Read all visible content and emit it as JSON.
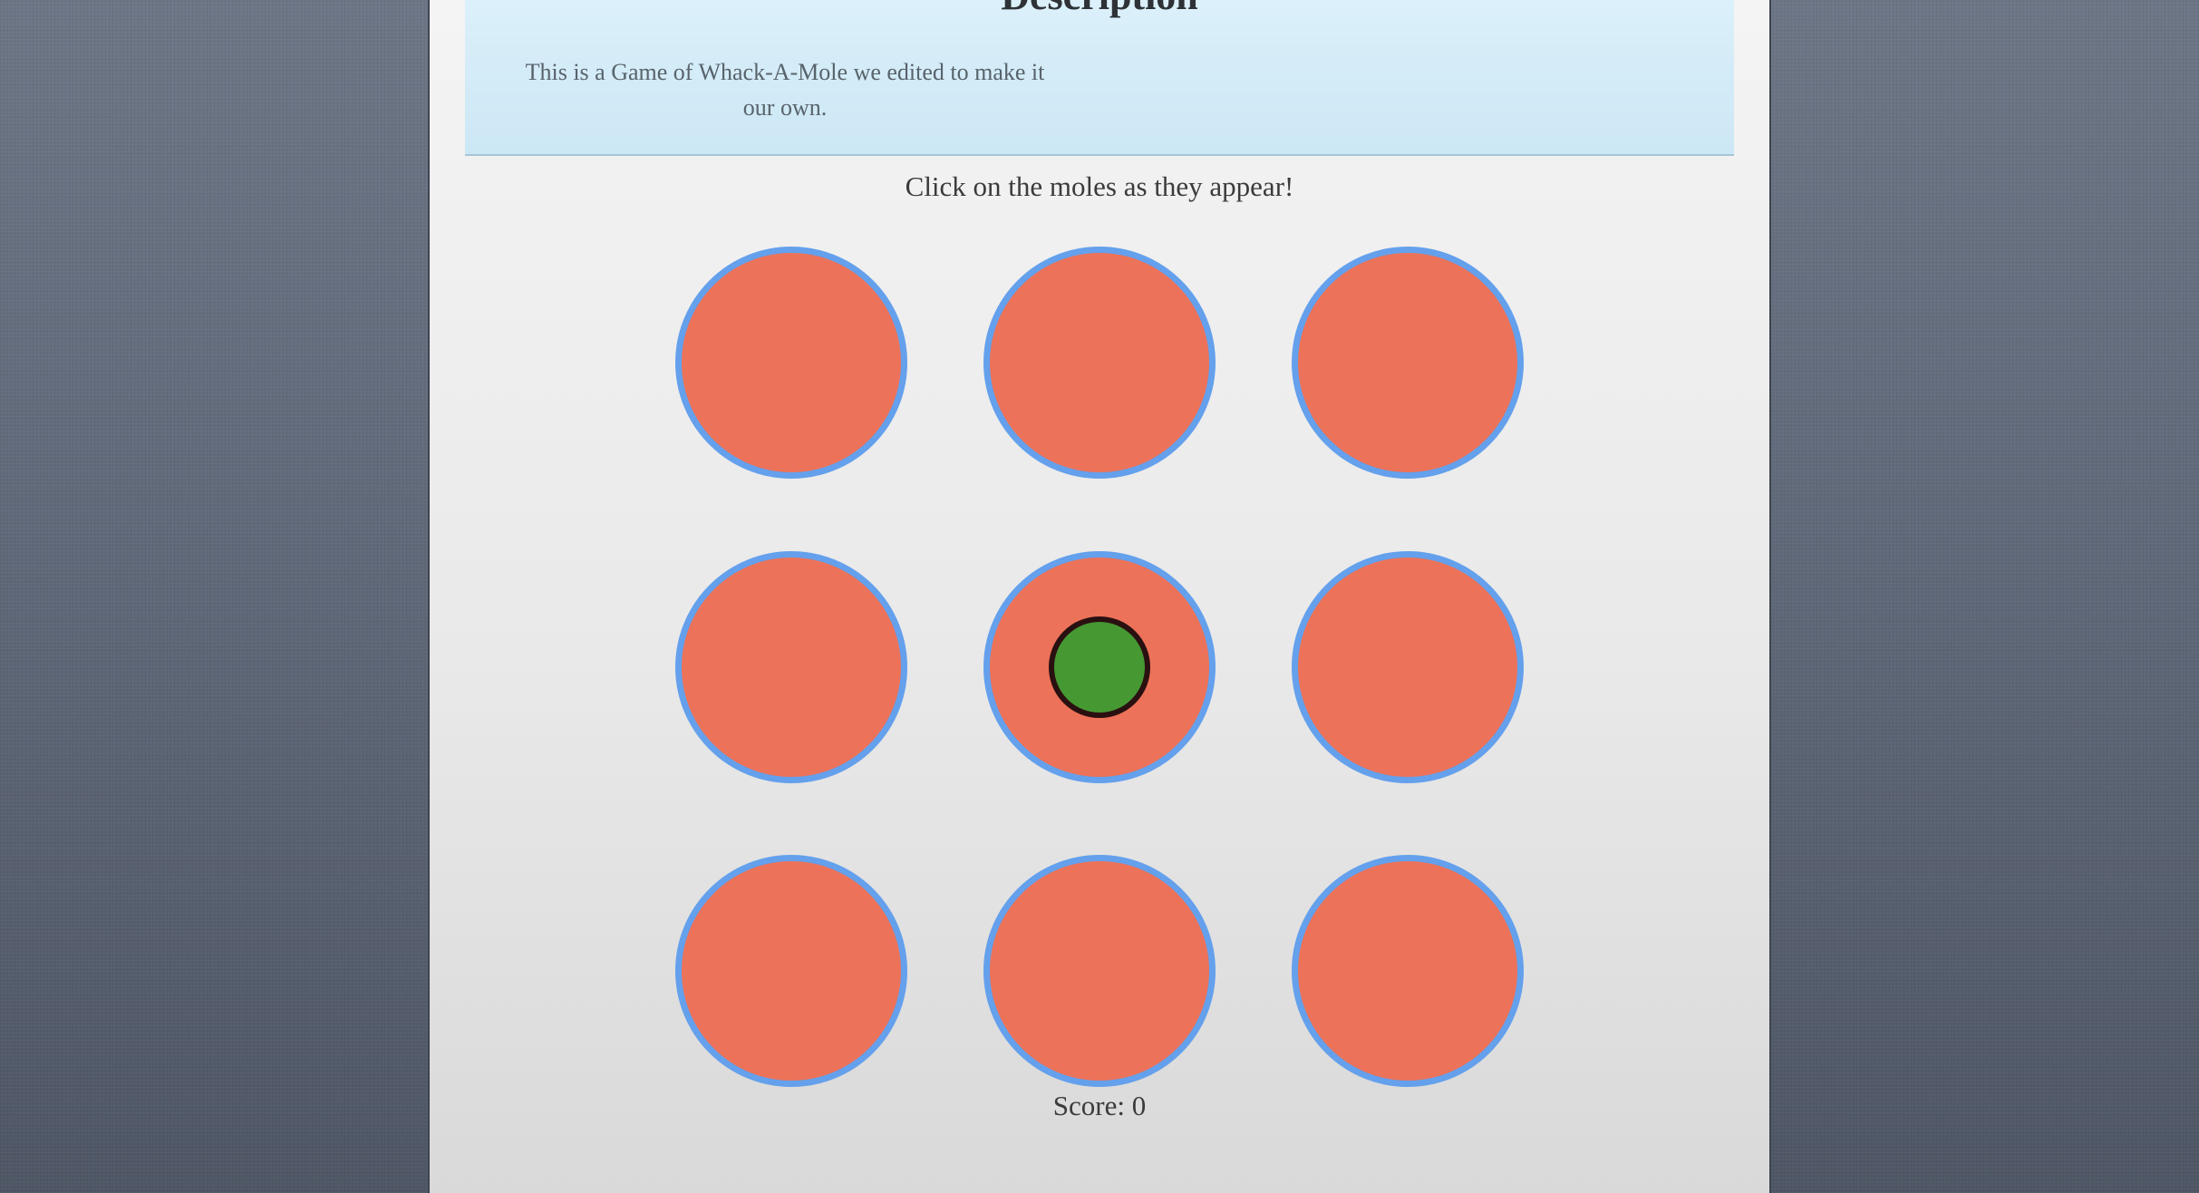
{
  "description": {
    "title": "Description",
    "text": "This is a Game of Whack-A-Mole we edited to make it our own."
  },
  "instructions": "Click on the moles as they appear!",
  "score": {
    "label": "Score: 0",
    "value": 0
  },
  "board": {
    "rows": 3,
    "columns": 3,
    "active_mole_hole": 5
  },
  "colors": {
    "hole_fill": "#ec7259",
    "hole_border": "#64a0ec",
    "mole_fill": "#469833",
    "mole_border": "#2a1010",
    "description_bg": "#d4edf8"
  }
}
